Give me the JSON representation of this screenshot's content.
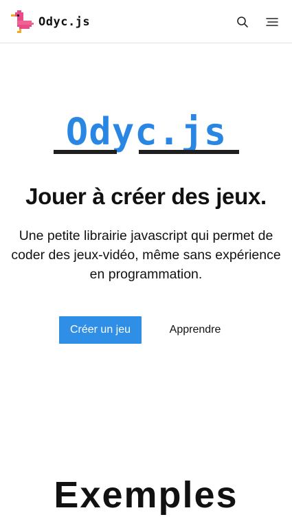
{
  "navbar": {
    "brand_name": "Odyc.js",
    "search_icon": "search-icon",
    "menu_icon": "hamburger-menu-icon"
  },
  "hero": {
    "logo_text": "Odyc.js",
    "title": "Jouer à créer des jeux.",
    "description": "Une petite librairie javascript qui permet de coder des jeux-vidéo, même sans expérience en programmation.",
    "primary_button": "Créer un jeu",
    "secondary_button": "Apprendre"
  },
  "next_section": {
    "heading": "Exemples"
  },
  "colors": {
    "accent": "#2f8fe6",
    "logo_blue": "#2a86e3",
    "logo_underline": "#1f1f1f",
    "mascot_pink": "#f06292"
  }
}
